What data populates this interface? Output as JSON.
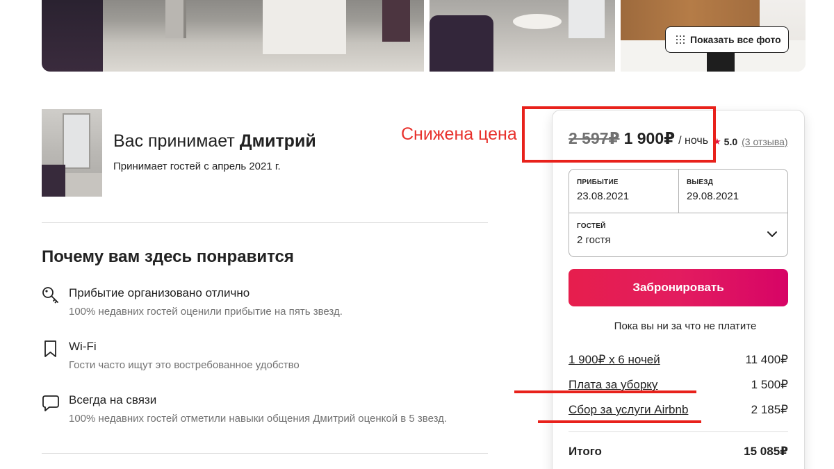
{
  "gallery": {
    "show_all_label": "Показать все фото",
    "show_all_icon": "grid-dots-icon"
  },
  "host": {
    "title_prefix": "Вас принимает ",
    "name": "Дмитрий",
    "since": "Принимает гостей с апрель 2021 г."
  },
  "annotation": {
    "promo_text": "Снижена цена",
    "color": "#e8211b"
  },
  "highlights": {
    "title": "Почему вам здесь понравится",
    "items": [
      {
        "icon": "key-icon",
        "title": "Прибытие организовано отлично",
        "subtitle": "100% недавних гостей оценили прибытие на пять звезд."
      },
      {
        "icon": "bookmark-icon",
        "title": "Wi-Fi",
        "subtitle": "Гости часто ищут это востребованное удобство"
      },
      {
        "icon": "chat-bubble-icon",
        "title": "Всегда на связи",
        "subtitle": "100% недавних гостей отметили навыки общения Дмитрий оценкой в 5 звезд."
      }
    ]
  },
  "booking": {
    "old_price": "2 597₽",
    "new_price": "1 900₽",
    "per_night": "/ ночь",
    "rating": "5.0",
    "reviews": "(3 отзыва)",
    "checkin_label": "ПРИБЫТИЕ",
    "checkin_value": "23.08.2021",
    "checkout_label": "ВЫЕЗД",
    "checkout_value": "29.08.2021",
    "guests_label": "ГОСТЕЙ",
    "guests_value": "2 гостя",
    "book_label": "Забронировать",
    "no_charge_note": "Пока вы ни за что не платите",
    "fees": [
      {
        "label": "1 900₽ x 6 ночей",
        "amount": "11 400₽"
      },
      {
        "label": "Плата за уборку",
        "amount": "1 500₽"
      },
      {
        "label": "Сбор за услуги Airbnb",
        "amount": "2 185₽"
      }
    ],
    "total_label": "Итого",
    "total_amount": "15 085₽",
    "accent_color": "#e61e4d"
  }
}
